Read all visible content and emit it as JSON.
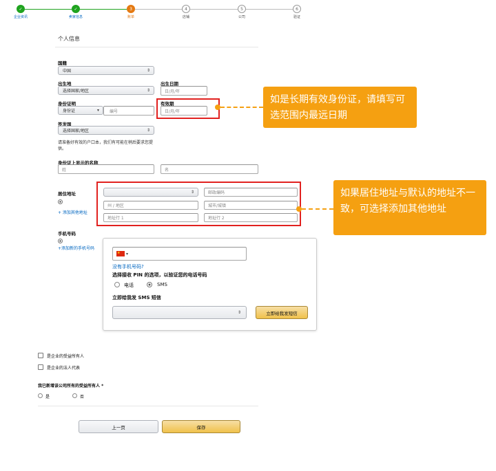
{
  "steps": [
    {
      "label": "企业资讯",
      "state": "done",
      "num": ""
    },
    {
      "label": "卖家信息",
      "state": "done",
      "num": ""
    },
    {
      "label": "账单",
      "state": "current",
      "num": "3"
    },
    {
      "label": "店铺",
      "state": "todo",
      "num": "4"
    },
    {
      "label": "公司",
      "state": "todo",
      "num": "5"
    },
    {
      "label": "验证",
      "state": "todo",
      "num": "6"
    }
  ],
  "section_title": "个人信息",
  "nationality": {
    "label": "国籍",
    "value": "中国"
  },
  "birthplace": {
    "label": "出生地",
    "value": "选择国家/地区"
  },
  "birthdate": {
    "label": "出生日期",
    "placeholder": "日/月/年"
  },
  "id_proof": {
    "label": "身份证明",
    "type_value": "身份证",
    "number_placeholder": "编号"
  },
  "expiry": {
    "label": "有效期",
    "placeholder": "日/月/年"
  },
  "issuing_country": {
    "label": "签发国",
    "value": "选择国家/地区"
  },
  "id_note": "请准备好有效的户口本，我们有可能在稍后要求您提供。",
  "name_on_id": {
    "label": "身份证上显示的名称",
    "last_placeholder": "姓",
    "first_placeholder": "名"
  },
  "address": {
    "label": "居住地址",
    "add_link": "+ 添加其他地址",
    "country_value": "",
    "postcode_placeholder": "邮政编码",
    "state_placeholder": "州 / 地区",
    "city_placeholder": "城市/城镇",
    "line1_placeholder": "地址行 1",
    "line2_placeholder": "地址行 2"
  },
  "phone": {
    "label": "手机号码",
    "add_link": "+添加新的手机号码",
    "no_phone_link": "没有手机号码?",
    "pin_label": "选择接收 PIN 的选项，以验证您的电话号码",
    "opt_call": "电话",
    "opt_sms": "SMS",
    "send_label": "立即给我发 SMS 短信",
    "send_button": "立即给我发短信",
    "flag": "cn-flag"
  },
  "checkboxes": {
    "beneficial_owner": "是企业的受益所有人",
    "legal_rep": "是企业的法人代表"
  },
  "added_all": {
    "question": "我已新增该公司所有的受益所有人 *",
    "yes": "是",
    "no": "否"
  },
  "buttons": {
    "prev": "上一页",
    "save": "保存"
  },
  "callouts": {
    "expiry": "如是长期有效身份证，请填写可选范围内最远日期",
    "address": "如果居住地址与默认的地址不一致，可选择添加其他地址"
  },
  "colors": {
    "accent": "#f5a011",
    "red": "#e1201e",
    "green": "#1fa31f",
    "orange_step": "#e47911"
  }
}
